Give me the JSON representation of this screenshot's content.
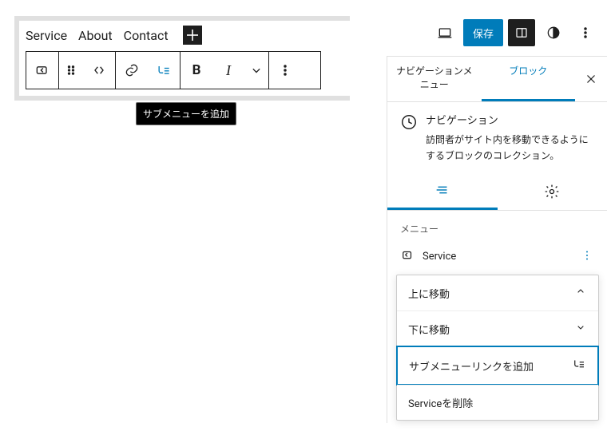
{
  "nav": {
    "items": [
      "Service",
      "About",
      "Contact"
    ]
  },
  "toolbar": {
    "tooltip": "サブメニューを追加"
  },
  "topbar": {
    "save": "保存"
  },
  "sidebar": {
    "tabs": {
      "nav_menu": "ナビゲーションメニュー",
      "block": "ブロック"
    },
    "block": {
      "title": "ナビゲーション",
      "desc": "訪問者がサイト内を移動できるようにするブロックのコレクション。"
    },
    "menu_section": {
      "heading": "メニュー",
      "item": "Service"
    },
    "dropdown": {
      "move_up": "上に移動",
      "move_down": "下に移動",
      "add_submenu": "サブメニューリンクを追加",
      "remove": "Serviceを削除"
    }
  }
}
